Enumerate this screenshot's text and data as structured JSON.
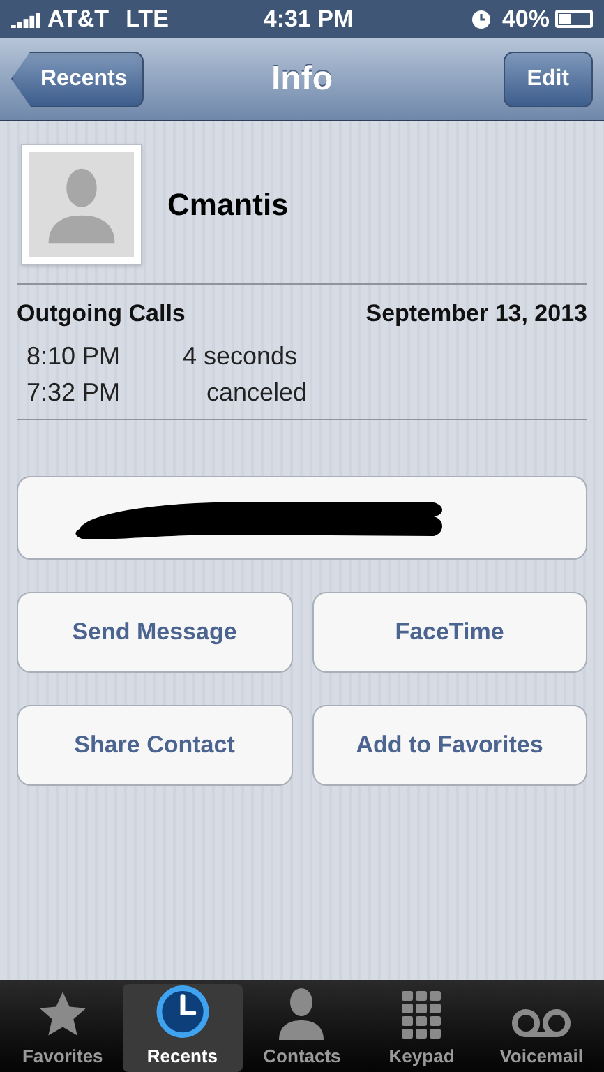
{
  "status_bar": {
    "carrier": "AT&T",
    "network": "LTE",
    "time": "4:31 PM",
    "battery": "40%"
  },
  "nav": {
    "back": "Recents",
    "title": "Info",
    "action": "Edit"
  },
  "contact": {
    "name": "Cmantis"
  },
  "calls": {
    "heading": "Outgoing Calls",
    "date": "September 13, 2013",
    "rows": [
      {
        "time": "8:10 PM",
        "detail": "4 seconds"
      },
      {
        "time": "7:32 PM",
        "detail": "canceled"
      }
    ]
  },
  "phone": {
    "redacted": true
  },
  "buttons": [
    "Send Message",
    "FaceTime",
    "Share Contact",
    "Add to Favorites"
  ],
  "tabs": [
    {
      "label": "Favorites",
      "kind": "star",
      "selected": false
    },
    {
      "label": "Recents",
      "kind": "clock",
      "selected": true
    },
    {
      "label": "Contacts",
      "kind": "person",
      "selected": false
    },
    {
      "label": "Keypad",
      "kind": "keypad",
      "selected": false
    },
    {
      "label": "Voicemail",
      "kind": "voicemail",
      "selected": false
    }
  ]
}
